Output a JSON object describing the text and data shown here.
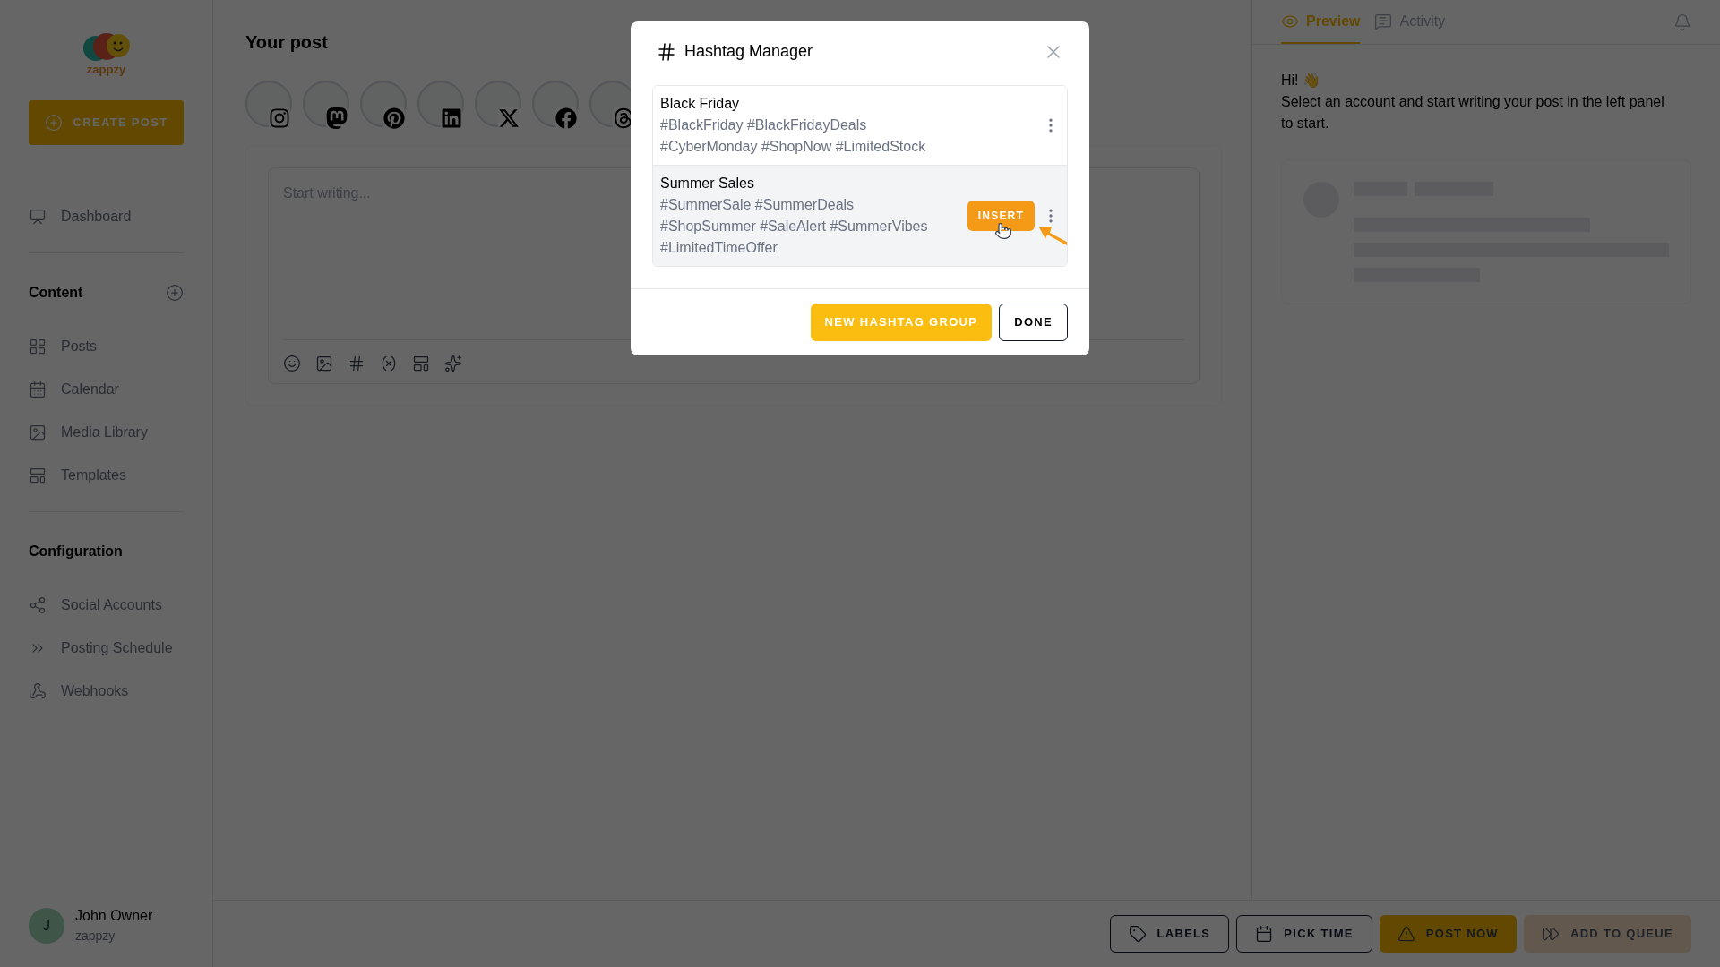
{
  "sidebar": {
    "logo_text": "zappzy",
    "create_button": "CREATE POST",
    "items": [
      {
        "label": "Dashboard"
      }
    ],
    "sections": [
      {
        "title": "Content",
        "add": true,
        "items": [
          {
            "label": "Posts"
          },
          {
            "label": "Calendar"
          },
          {
            "label": "Media Library"
          },
          {
            "label": "Templates"
          }
        ]
      },
      {
        "title": "Configuration",
        "add": false,
        "items": [
          {
            "label": "Social Accounts"
          },
          {
            "label": "Posting Schedule"
          },
          {
            "label": "Webhooks"
          }
        ]
      }
    ],
    "user": {
      "initial": "J",
      "name": "John Owner",
      "org": "zappzy"
    }
  },
  "editor": {
    "title": "Your post",
    "accounts": [
      {
        "kind": "instagram"
      },
      {
        "kind": "mastodon"
      },
      {
        "kind": "pinterest"
      },
      {
        "kind": "linkedin"
      },
      {
        "kind": "x"
      },
      {
        "kind": "facebook"
      },
      {
        "kind": "threads"
      }
    ],
    "placeholder": "Start writing..."
  },
  "preview": {
    "tabs": [
      {
        "label": "Preview",
        "selected": true
      },
      {
        "label": "Activity",
        "selected": false
      }
    ],
    "greeting": "Hi! 👋",
    "message": "Select an account and start writing your post in the left panel to start."
  },
  "actions": [
    {
      "label": "LABELS",
      "kind": "outline"
    },
    {
      "label": "PICK TIME",
      "kind": "outline"
    },
    {
      "label": "POST NOW",
      "kind": "primary"
    },
    {
      "label": "ADD TO QUEUE",
      "kind": "soft"
    }
  ],
  "modal": {
    "title": "Hashtag Manager",
    "groups": [
      {
        "name": "Black Friday",
        "tags": "#BlackFriday #BlackFridayDeals #CyberMonday #ShopNow #LimitedStock",
        "selected": false
      },
      {
        "name": "Summer Sales",
        "tags": "#SummerSale #SummerDeals #ShopSummer #SaleAlert #SummerVibes #LimitedTimeOffer",
        "selected": true
      }
    ],
    "insert_button": "INSERT",
    "new_button": "NEW HASHTAG GROUP",
    "done_button": "DONE"
  }
}
